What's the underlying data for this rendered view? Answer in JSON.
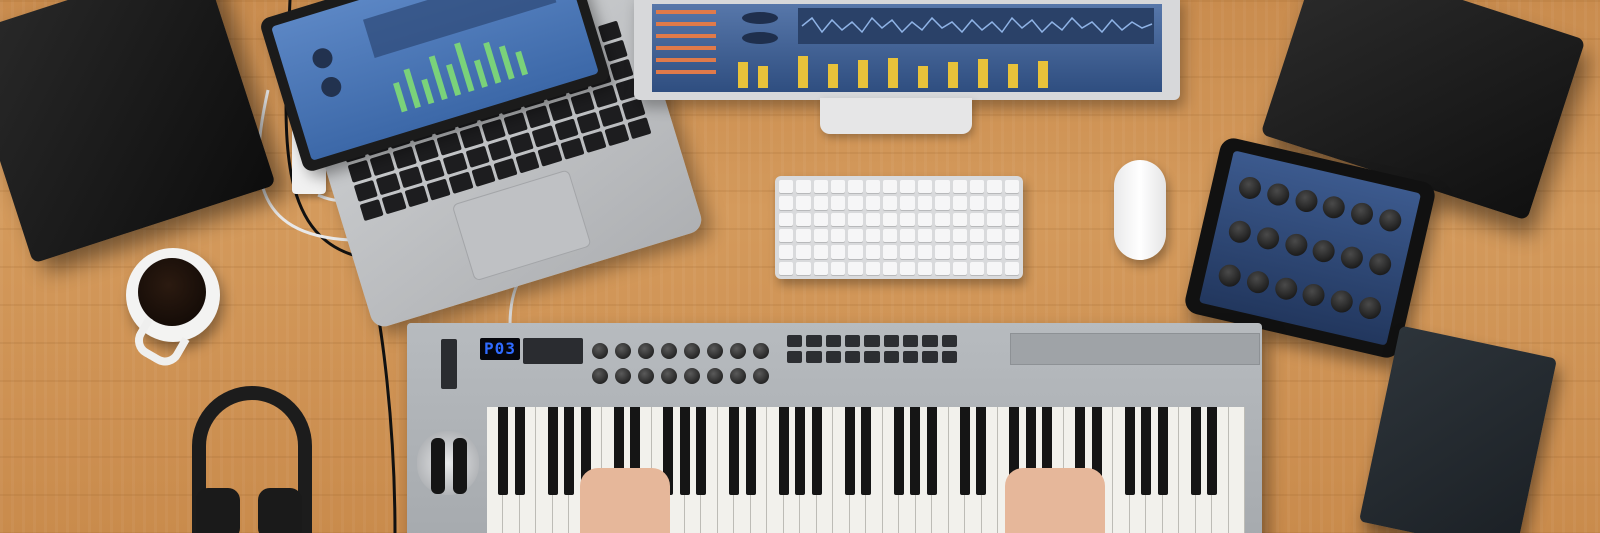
{
  "scene": {
    "description_objects": [
      "speaker-left",
      "laptop",
      "monitor",
      "speaker-right",
      "keyboard",
      "mouse",
      "tablet",
      "notebook",
      "coffee-mug",
      "headphones",
      "midi-controller"
    ]
  },
  "midi_controller": {
    "display_value": "P03"
  },
  "colors": {
    "desk_wood": "#d49a5c",
    "screen_blue": "#4b72ad",
    "lcd_blue": "#2f6bff",
    "controller_silver": "#b0b4b8"
  }
}
